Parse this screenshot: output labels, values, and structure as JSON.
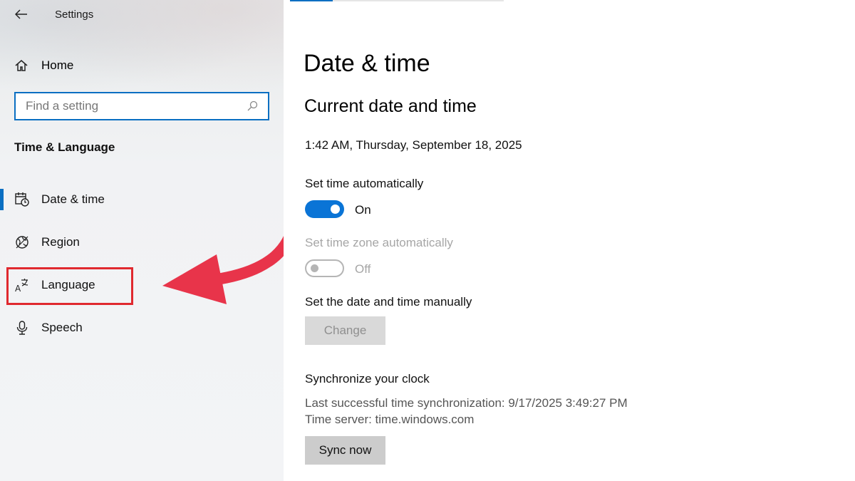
{
  "window": {
    "title": "Settings"
  },
  "sidebar": {
    "home_label": "Home",
    "search": {
      "placeholder": "Find a setting"
    },
    "section_title": "Time & Language",
    "items": [
      {
        "label": "Date & time",
        "icon": "calendar-clock-icon",
        "selected": true
      },
      {
        "label": "Region",
        "icon": "globe-icon",
        "selected": false
      },
      {
        "label": "Language",
        "icon": "language-icon",
        "selected": false
      },
      {
        "label": "Speech",
        "icon": "microphone-icon",
        "selected": false
      }
    ]
  },
  "main": {
    "page_title": "Date & time",
    "section_title": "Current date and time",
    "current_datetime": "1:42 AM, Thursday, September 18, 2025",
    "set_time_auto": {
      "label": "Set time automatically",
      "state": "On"
    },
    "set_timezone_auto": {
      "label": "Set time zone automatically",
      "state": "Off"
    },
    "manual": {
      "label": "Set the date and time manually",
      "button": "Change"
    },
    "sync": {
      "title": "Synchronize your clock",
      "last_sync": "Last successful time synchronization: 9/17/2025 3:49:27 PM",
      "server": "Time server: time.windows.com",
      "button": "Sync now"
    }
  },
  "colors": {
    "accent": "#0a6fc2",
    "annotation": "#e0292f"
  }
}
